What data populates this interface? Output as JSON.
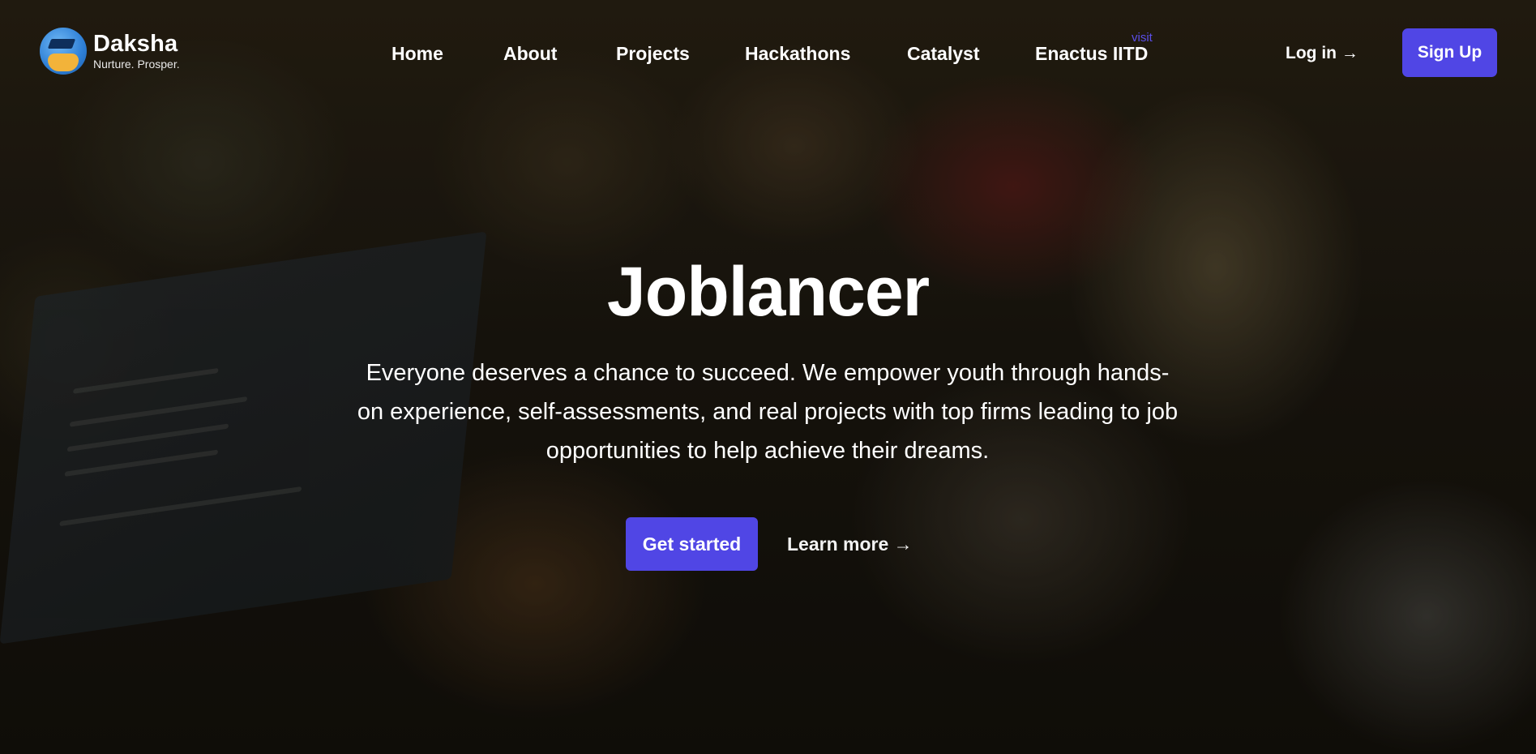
{
  "brand": {
    "name": "Daksha",
    "tagline": "Nurture. Prosper."
  },
  "nav": {
    "links": [
      {
        "label": "Home"
      },
      {
        "label": "About"
      },
      {
        "label": "Projects"
      },
      {
        "label": "Hackathons"
      },
      {
        "label": "Catalyst"
      },
      {
        "label": "Enactus IITD"
      }
    ],
    "visit_badge": "visit",
    "login_label": "Log in →",
    "signup_label": "Sign Up"
  },
  "hero": {
    "title": "Joblancer",
    "description": "Everyone deserves a chance to succeed. We empower youth through hands-on experience, self-assessments, and real projects with top firms leading to job opportunities to help achieve their dreams.",
    "primary_cta": "Get started",
    "secondary_cta": "Learn more →"
  },
  "colors": {
    "accent": "#5046e5",
    "visit_badge": "#5b4ee8",
    "text": "#ffffff"
  },
  "icons": {
    "logo": "graduation-cap-globe-icon"
  }
}
